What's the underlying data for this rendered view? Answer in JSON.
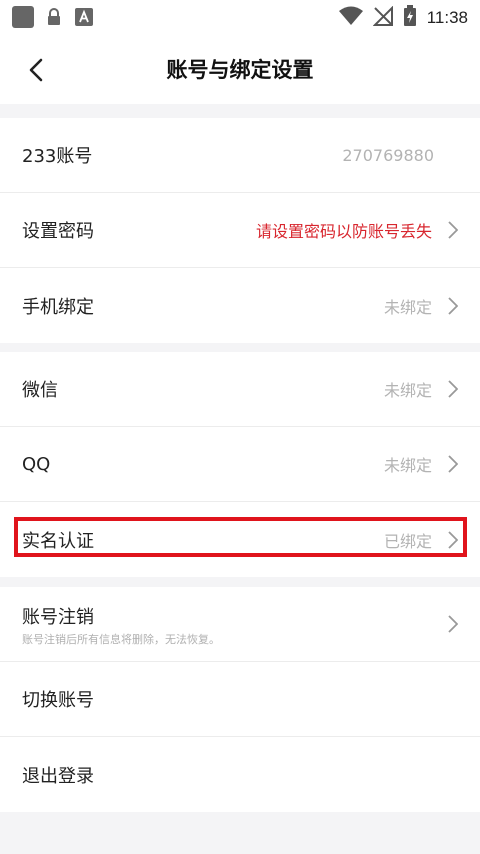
{
  "status_bar": {
    "time": "11:38",
    "left_icons": [
      "app-icon",
      "lock-icon",
      "a-icon"
    ],
    "right_icons": [
      "wifi-icon",
      "no-signal-icon",
      "battery-charging-icon"
    ]
  },
  "nav": {
    "title": "账号与绑定设置",
    "back_icon": "chevron-left-icon"
  },
  "groups": [
    {
      "rows": [
        {
          "label": "233账号",
          "value": "270769880"
        },
        {
          "label": "设置密码",
          "value": "请设置密码以防账号丢失"
        },
        {
          "label": "手机绑定",
          "value": "未绑定"
        }
      ]
    },
    {
      "rows": [
        {
          "label": "微信",
          "value": "未绑定"
        },
        {
          "label": "QQ",
          "value": "未绑定"
        },
        {
          "label": "实名认证",
          "value": "已绑定"
        }
      ]
    },
    {
      "rows": [
        {
          "label": "账号注销",
          "sublabel": "账号注销后所有信息将删除，无法恢复。"
        },
        {
          "label": "切换账号"
        },
        {
          "label": "退出登录"
        }
      ]
    }
  ],
  "colors": {
    "warning": "#d8262e",
    "highlight": "#e0141c",
    "secondary_text": "#b3b3b3"
  }
}
